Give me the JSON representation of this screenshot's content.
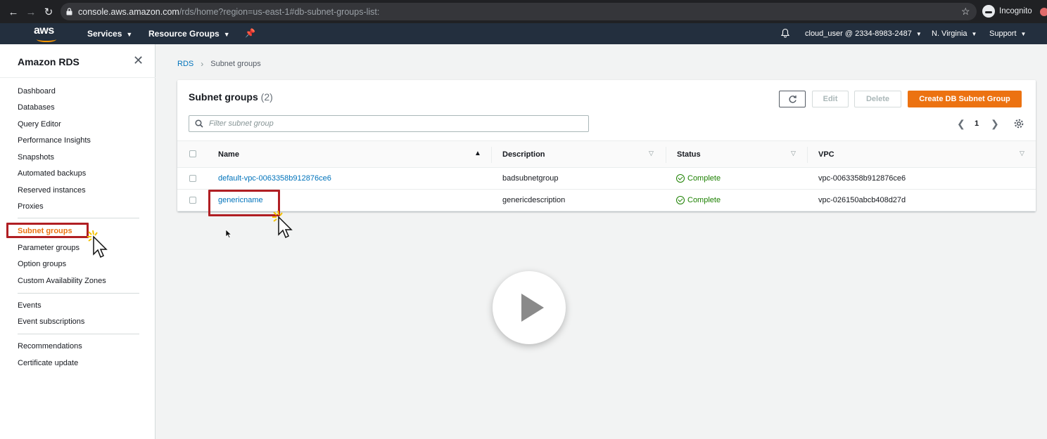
{
  "browser": {
    "url_host": "console.aws.amazon.com",
    "url_path": "/rds/home?region=us-east-1#db-subnet-groups-list:",
    "incognito_label": "Incognito"
  },
  "topnav": {
    "logo": "aws",
    "services": "Services",
    "resource_groups": "Resource Groups",
    "account": "cloud_user @ 2334-8983-2487",
    "region": "N. Virginia",
    "support": "Support"
  },
  "sidebar": {
    "title": "Amazon RDS",
    "groups": [
      [
        "Dashboard",
        "Databases",
        "Query Editor",
        "Performance Insights",
        "Snapshots",
        "Automated backups",
        "Reserved instances",
        "Proxies"
      ],
      [
        "Subnet groups",
        "Parameter groups",
        "Option groups",
        "Custom Availability Zones"
      ],
      [
        "Events",
        "Event subscriptions"
      ],
      [
        "Recommendations",
        "Certificate update"
      ]
    ],
    "active_item": "Subnet groups"
  },
  "breadcrumb": {
    "root": "RDS",
    "current": "Subnet groups"
  },
  "panel": {
    "title": "Subnet groups",
    "count": "(2)",
    "buttons": {
      "edit": "Edit",
      "delete": "Delete",
      "create": "Create DB Subnet Group"
    },
    "filter_placeholder": "Filter subnet group",
    "page_number": "1"
  },
  "table": {
    "columns": [
      "Name",
      "Description",
      "Status",
      "VPC"
    ],
    "rows": [
      {
        "name": "default-vpc-0063358b912876ce6",
        "description": "badsubnetgroup",
        "status": "Complete",
        "vpc": "vpc-0063358b912876ce6"
      },
      {
        "name": "genericname",
        "description": "genericdescription",
        "status": "Complete",
        "vpc": "vpc-026150abcb408d27d"
      }
    ]
  },
  "colors": {
    "accent": "#ec7211",
    "link": "#0073bb",
    "status_ok": "#1d8102",
    "highlight": "#b01e23",
    "aws_nav": "#232f3e"
  },
  "icons": [
    "back-icon",
    "forward-icon",
    "reload-icon",
    "lock-icon",
    "star-icon",
    "incognito-icon",
    "pin-icon",
    "bell-icon",
    "close-icon",
    "chevron-right-icon",
    "refresh-icon",
    "search-icon",
    "chevron-left-icon",
    "settings-icon",
    "sort-asc-icon",
    "sort-desc-icon",
    "check-circle-icon",
    "play-icon",
    "cursor-icon"
  ]
}
